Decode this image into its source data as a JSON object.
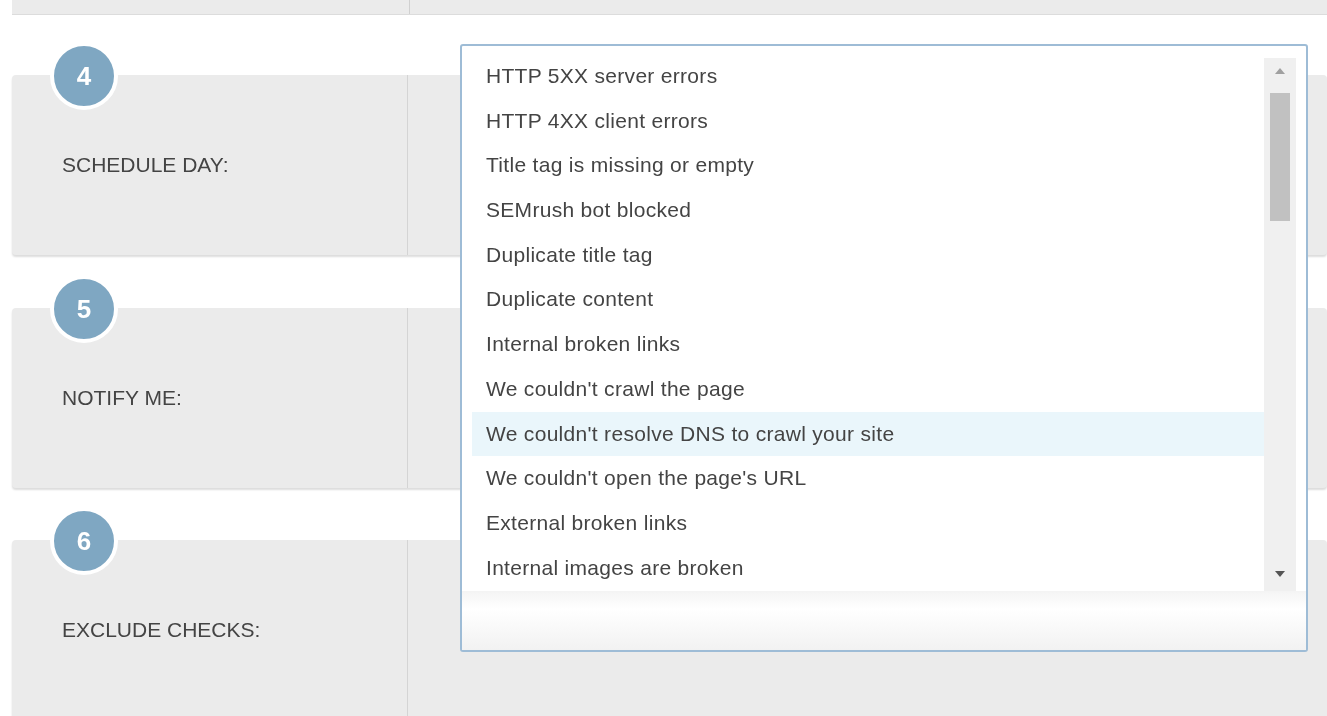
{
  "steps": [
    {
      "number": "4",
      "label": "SCHEDULE DAY:"
    },
    {
      "number": "5",
      "label": "NOTIFY ME:"
    },
    {
      "number": "6",
      "label": "EXCLUDE CHECKS:"
    }
  ],
  "checks_dropdown": {
    "options": [
      {
        "label": "HTTP 5XX server errors",
        "selected": false
      },
      {
        "label": "HTTP 4XX client errors",
        "selected": false
      },
      {
        "label": "Title tag is missing or empty",
        "selected": false
      },
      {
        "label": "SEMrush bot blocked",
        "selected": false
      },
      {
        "label": "Duplicate title tag",
        "selected": false
      },
      {
        "label": "Duplicate content",
        "selected": false
      },
      {
        "label": "Internal broken links",
        "selected": false
      },
      {
        "label": "We couldn't crawl the page",
        "selected": false
      },
      {
        "label": "We couldn't resolve DNS to crawl your site",
        "selected": true
      },
      {
        "label": "We couldn't open the page's URL",
        "selected": false
      },
      {
        "label": "External broken links",
        "selected": false
      },
      {
        "label": "Internal images are broken",
        "selected": false
      }
    ]
  }
}
